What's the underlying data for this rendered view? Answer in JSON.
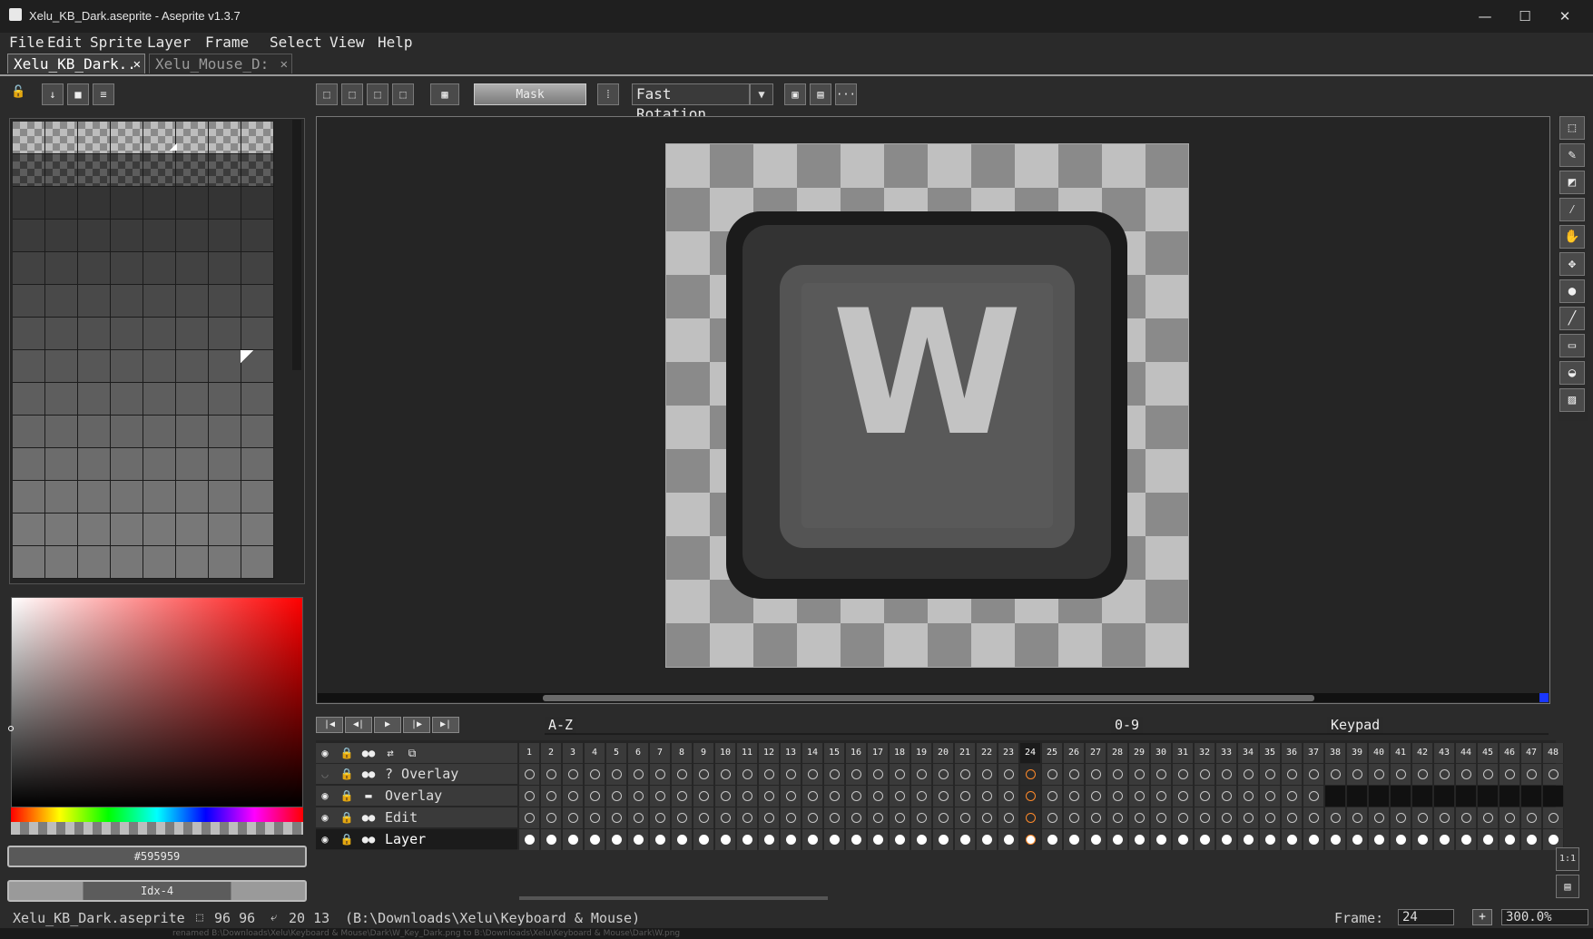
{
  "window": {
    "title": "Xelu_KB_Dark.aseprite - Aseprite v1.3.7",
    "minimize": "—",
    "maximize": "☐",
    "close": "✕"
  },
  "menu": [
    "File",
    "Edit",
    "Sprite",
    "Layer",
    "Frame",
    "Select",
    "View",
    "Help"
  ],
  "tabs": {
    "active": "Xelu_KB_Dark..",
    "inactive": "Xelu_Mouse_D:",
    "close_glyph": "✕"
  },
  "context_bar": {
    "mask_label": "Mask",
    "rotation_algorithm": "Fast Rotation",
    "dropdown_glyph": "▼",
    "more_glyph": "···"
  },
  "color": {
    "hex": "#595959",
    "index": "Idx-4"
  },
  "canvas": {
    "key_glyph": "W"
  },
  "timeline": {
    "tags": [
      "A-Z",
      "0-9",
      "Keypad"
    ],
    "frames_visible": 48,
    "current_frame": 24,
    "layers": [
      {
        "name": "? Overlay",
        "visible": false,
        "locked": true
      },
      {
        "name": "Overlay",
        "visible": true,
        "locked": true
      },
      {
        "name": "Edit",
        "visible": true,
        "locked": true
      },
      {
        "name": "Layer",
        "visible": true,
        "locked": true,
        "selected": true
      }
    ],
    "ratio_glyph": "1:1"
  },
  "status": {
    "filename": "Xelu_KB_Dark.aseprite",
    "size": "96 96",
    "position": "20 13",
    "path": "(B:\\Downloads\\Xelu\\Keyboard & Mouse)",
    "frame_label": "Frame:",
    "frame_value": "24",
    "add_glyph": "+",
    "zoom": "300.0%",
    "bottom_text": "renamed  B:\\Downloads\\Xelu\\Keyboard & Mouse\\Dark\\W_Key_Dark.png  to  B:\\Downloads\\Xelu\\Keyboard & Mouse\\Dark\\W.png"
  }
}
